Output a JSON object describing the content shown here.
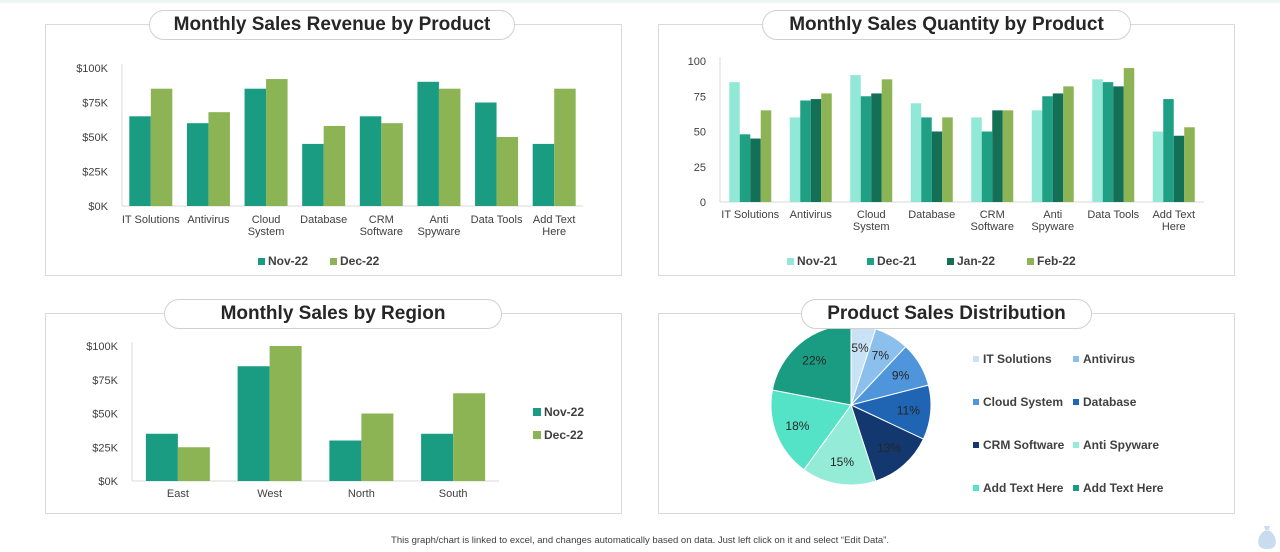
{
  "panels": {
    "revenue_title": "Monthly Sales Revenue by Product",
    "quantity_title": "Monthly Sales Quantity by Product",
    "region_title": "Monthly Sales by Region",
    "distribution_title": "Product Sales Distribution"
  },
  "footer": {
    "note": "This graph/chart is linked to excel, and changes automatically based on data. Just left click on it and select “Edit Data”."
  },
  "icons": {
    "corner": "money-bag-icon"
  },
  "chart_data": [
    {
      "id": "revenue",
      "type": "bar",
      "title": "Monthly Sales Revenue by Product",
      "categories": [
        "IT Solutions",
        "Antivirus",
        "Cloud System",
        "Database",
        "CRM Software",
        "Anti Spyware",
        "Data Tools",
        "Add Text Here"
      ],
      "category_lines": [
        [
          "IT Solutions"
        ],
        [
          "Antivirus"
        ],
        [
          "Cloud",
          "System"
        ],
        [
          "Database"
        ],
        [
          "CRM",
          "Software"
        ],
        [
          "Anti",
          "Spyware"
        ],
        [
          "Data Tools"
        ],
        [
          "Add Text",
          "Here"
        ]
      ],
      "series": [
        {
          "name": "Nov-22",
          "color": "#1a9c83",
          "values": [
            65000,
            60000,
            85000,
            45000,
            65000,
            90000,
            75000,
            45000
          ]
        },
        {
          "name": "Dec-22",
          "color": "#8db454",
          "values": [
            85000,
            68000,
            92000,
            58000,
            60000,
            85000,
            50000,
            85000
          ]
        }
      ],
      "ylim": [
        0,
        100000
      ],
      "ytick_values": [
        0,
        25000,
        50000,
        75000,
        100000
      ],
      "ytick_labels": [
        "$0K",
        "$25K",
        "$50K",
        "$75K",
        "$100K"
      ],
      "grid": false,
      "legend_position": "bottom"
    },
    {
      "id": "quantity",
      "type": "bar",
      "title": "Monthly Sales Quantity by Product",
      "categories": [
        "IT Solutions",
        "Antivirus",
        "Cloud System",
        "Database",
        "CRM Software",
        "Anti Spyware",
        "Data Tools",
        "Add Text Here"
      ],
      "category_lines": [
        [
          "IT Solutions"
        ],
        [
          "Antivirus"
        ],
        [
          "Cloud",
          "System"
        ],
        [
          "Database"
        ],
        [
          "CRM",
          "Software"
        ],
        [
          "Anti",
          "Spyware"
        ],
        [
          "Data Tools"
        ],
        [
          "Add Text",
          "Here"
        ]
      ],
      "series": [
        {
          "name": "Nov-21",
          "color": "#92e8d6",
          "values": [
            85,
            60,
            90,
            70,
            60,
            65,
            87,
            50
          ]
        },
        {
          "name": "Dec-21",
          "color": "#1fa084",
          "values": [
            48,
            72,
            75,
            60,
            50,
            75,
            85,
            73
          ]
        },
        {
          "name": "Jan-22",
          "color": "#136f55",
          "values": [
            45,
            73,
            77,
            50,
            65,
            77,
            82,
            47
          ]
        },
        {
          "name": "Feb-22",
          "color": "#8db454",
          "values": [
            65,
            77,
            87,
            60,
            65,
            82,
            95,
            53
          ]
        }
      ],
      "ylim": [
        0,
        100
      ],
      "ytick_values": [
        0,
        25,
        50,
        75,
        100
      ],
      "ytick_labels": [
        "0",
        "25",
        "50",
        "75",
        "100"
      ],
      "grid": false,
      "legend_position": "bottom"
    },
    {
      "id": "region",
      "type": "bar",
      "title": "Monthly Sales by Region",
      "categories": [
        "East",
        "West",
        "North",
        "South"
      ],
      "category_lines": [
        [
          "East"
        ],
        [
          "West"
        ],
        [
          "North"
        ],
        [
          "South"
        ]
      ],
      "series": [
        {
          "name": "Nov-22",
          "color": "#1a9c83",
          "values": [
            35000,
            85000,
            30000,
            35000
          ]
        },
        {
          "name": "Dec-22",
          "color": "#8db454",
          "values": [
            25000,
            100000,
            50000,
            65000
          ]
        }
      ],
      "ylim": [
        0,
        100000
      ],
      "ytick_values": [
        0,
        25000,
        50000,
        75000,
        100000
      ],
      "ytick_labels": [
        "$0K",
        "$25K",
        "$50K",
        "$75K",
        "$100K"
      ],
      "grid": false,
      "legend_position": "right"
    },
    {
      "id": "distribution",
      "type": "pie",
      "title": "Product Sales Distribution",
      "labels": [
        "IT Solutions",
        "Antivirus",
        "Cloud System",
        "Database",
        "CRM Software",
        "Anti Spyware",
        "Add Text Here",
        "Add Text Here"
      ],
      "values": [
        5,
        7,
        9,
        11,
        13,
        15,
        18,
        22
      ],
      "value_labels": [
        "5%",
        "7%",
        "9%",
        "11%",
        "13%",
        "15%",
        "18%",
        "22%"
      ],
      "colors": [
        "#c9e2f5",
        "#8cc0ec",
        "#4f95dc",
        "#1f65b4",
        "#12386f",
        "#94ecd8",
        "#55e3c8",
        "#1a9c83"
      ],
      "legend_position": "right"
    }
  ]
}
